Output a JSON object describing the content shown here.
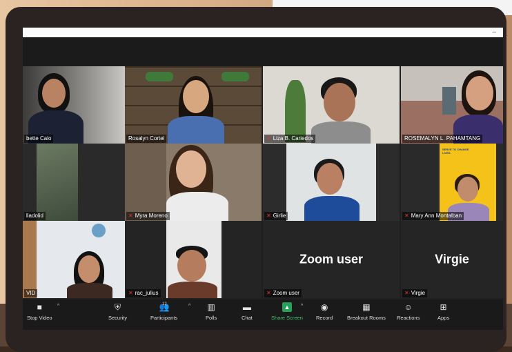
{
  "participants": [
    {
      "name": "bette Calo",
      "muted": false,
      "active": false
    },
    {
      "name": "Rosalyn Cortel",
      "muted": false,
      "active": true
    },
    {
      "name": "Liza B. Cariedos",
      "muted": true,
      "active": false
    },
    {
      "name": "ROSEMALYN L. PAHAMTANG",
      "muted": false,
      "active": false
    },
    {
      "name": "lladolid",
      "muted": false,
      "active": false
    },
    {
      "name": "Myra Moreno",
      "muted": true,
      "active": false
    },
    {
      "name": "Girlie",
      "muted": true,
      "active": false
    },
    {
      "name": "Mary Ann Montalban",
      "muted": true,
      "active": false
    },
    {
      "name": "VID",
      "muted": false,
      "active": false
    },
    {
      "name": "rac_julius",
      "muted": true,
      "active": false
    },
    {
      "name": "Zoom user",
      "muted": true,
      "active": false,
      "display_text": "Zoom user"
    },
    {
      "name": "Virgie",
      "muted": true,
      "active": false,
      "display_text": "Virgie"
    }
  ],
  "toolbar": {
    "stop_video": "Stop Video",
    "security": "Security",
    "participants": "Participants",
    "participants_count": "12",
    "polls": "Polls",
    "chat": "Chat",
    "share_screen": "Share Screen",
    "record": "Record",
    "breakout_rooms": "Breakout Rooms",
    "reactions": "Reactions",
    "apps": "Apps"
  },
  "window": {
    "minimize": "–"
  },
  "poster_text": "SERVE TO CHANGE LIVES",
  "colors": {
    "active_speaker": "#b9e04a",
    "share_green": "#27a05a",
    "muted_red": "#e23b2e",
    "poster_yellow": "#f5c21a"
  }
}
